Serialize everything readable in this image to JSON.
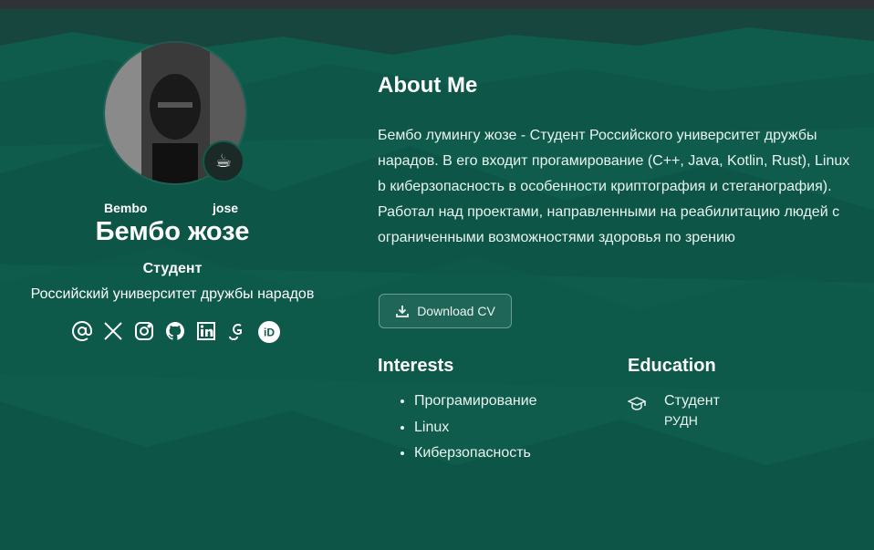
{
  "profile": {
    "first_name": "Bembo",
    "last_name": "jose",
    "full_name": "Бембо жозе",
    "role": "Студент",
    "organization": "Российский университет дружбы нарадов",
    "status_emoji": "☕",
    "socials": [
      {
        "icon": "email-icon"
      },
      {
        "icon": "x-twitter-icon"
      },
      {
        "icon": "instagram-icon"
      },
      {
        "icon": "github-icon"
      },
      {
        "icon": "linkedin-icon"
      },
      {
        "icon": "google-scholar-icon"
      },
      {
        "icon": "orcid-icon"
      }
    ]
  },
  "about": {
    "title": "About Me",
    "text": "Бембо лумингу жозе - Студент Российского университет дружбы нарадов. В его входит прогамирование (C++, Java, Kotlin, Rust), Linux b киберзопасность в особенности криптография и стеганография). Работал над проектами, направленными на реабилитацию людей с ограниченными возможностями здоровья по зрению",
    "cv_button": "Download CV"
  },
  "interests": {
    "title": "Interests",
    "items": [
      "Програмирование",
      "Linux",
      "Киберзопасность"
    ]
  },
  "education": {
    "title": "Education",
    "items": [
      {
        "degree": "Студент",
        "institution": "РУДН"
      }
    ]
  },
  "colors": {
    "background": "#0f5c4c",
    "topbar": "#2f3236",
    "text": "#ffffff"
  }
}
